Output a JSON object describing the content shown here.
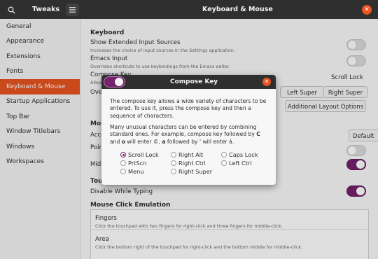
{
  "titlebar": {
    "app_title": "Tweaks",
    "window_title": "Keyboard & Mouse",
    "search_icon": "search-icon",
    "menu_icon": "hamburger-menu-icon",
    "close_icon": "close-icon"
  },
  "sidebar": {
    "items": [
      {
        "label": "General"
      },
      {
        "label": "Appearance"
      },
      {
        "label": "Extensions"
      },
      {
        "label": "Fonts"
      },
      {
        "label": "Keyboard & Mouse"
      },
      {
        "label": "Startup Applications"
      },
      {
        "label": "Top Bar"
      },
      {
        "label": "Window Titlebars"
      },
      {
        "label": "Windows"
      },
      {
        "label": "Workspaces"
      }
    ],
    "active_index": 4
  },
  "main": {
    "keyboard": {
      "heading": "Keyboard",
      "show_ext_label": "Show Extended Input Sources",
      "show_ext_desc": "Increases the choice of input sources in the Settings application.",
      "emacs_label": "Emacs Input",
      "emacs_desc": "Overrides shortcuts to use keybindings from the Emacs editor.",
      "compose_label": "Compose Key",
      "compose_value": "Scroll Lock",
      "allow_fragment": "Allow",
      "overview_fragment": "Ove",
      "super_left": "Left Super",
      "super_right": "Right Super",
      "additional_layout": "Additional Layout Options"
    },
    "mouse": {
      "heading_fragment": "Mou",
      "accel_fragment": "Acce",
      "accel_value": "Default",
      "pointer_fragment": "Poin",
      "middle_fragment": "Midd"
    },
    "touchpad": {
      "heading_fragment": "Touc",
      "disable_typing": "Disable While Typing"
    },
    "emulation": {
      "heading": "Mouse Click Emulation",
      "fingers_title": "Fingers",
      "fingers_desc": "Click the touchpad with two fingers for right-click and three fingers for middle-click.",
      "area_title": "Area",
      "area_desc": "Click the bottom right of the touchpad for right-click and the bottom middle for middle-click."
    }
  },
  "dialog": {
    "title": "Compose Key",
    "para1": "The compose key allows a wide variety of characters to be entered. To use it, press the compose key and then a sequence of characters.",
    "para2a": "Many unusual characters can be entered by combining standard ones. For example, compose key followed by ",
    "para2_c": "C",
    "para2b": " and ",
    "para2_o": "o",
    "para2c": " will enter ©, ",
    "para2_a": "a",
    "para2d": " followed by ' will enter á.",
    "options": [
      {
        "label": "Scroll Lock",
        "selected": true
      },
      {
        "label": "Right Alt",
        "selected": false
      },
      {
        "label": "Caps Lock",
        "selected": false
      },
      {
        "label": "PrtScn",
        "selected": false
      },
      {
        "label": "Right Ctrl",
        "selected": false
      },
      {
        "label": "Left Ctrl",
        "selected": false
      },
      {
        "label": "Menu",
        "selected": false
      },
      {
        "label": "Right Super",
        "selected": false
      }
    ]
  },
  "colors": {
    "accent_orange": "#e95420",
    "toggle_purple": "#77216f",
    "titlebar_dark": "#2f2f2f"
  }
}
